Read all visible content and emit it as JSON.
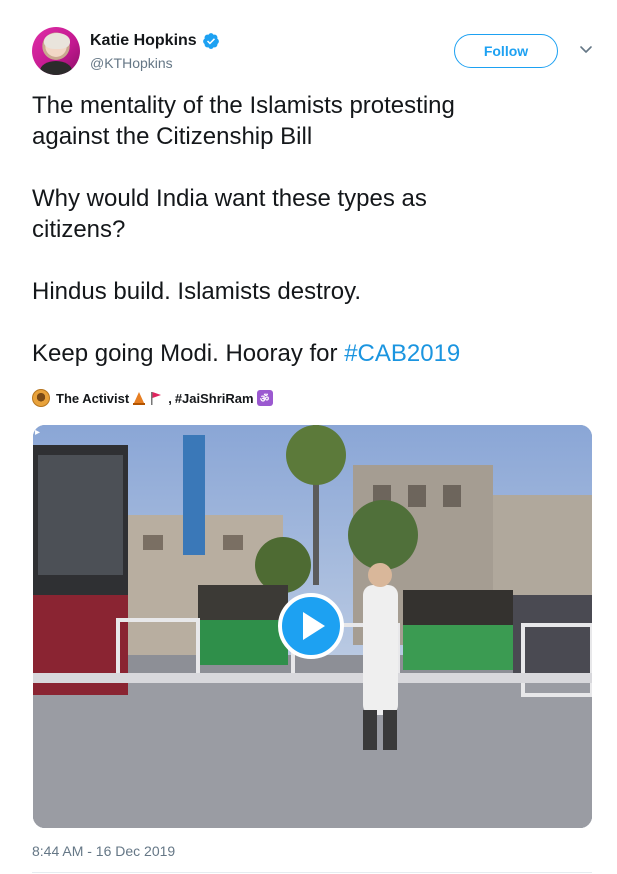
{
  "author": {
    "display_name": "Katie Hopkins",
    "handle": "@KTHopkins",
    "verified": true
  },
  "actions": {
    "follow_label": "Follow",
    "caret_icon": "chevron-down-icon"
  },
  "tweet": {
    "lines": [
      "The mentality of the Islamists protesting",
      "against the Citizenship Bill",
      "Why would India want these types as",
      "citizens?",
      "Hindus build. Islamists destroy."
    ],
    "last_line_text": "Keep going Modi. Hooray for ",
    "hashtag": "#CAB2019"
  },
  "media_attribution": {
    "name": "The Activist",
    "separator": ",",
    "tag": "#JaiShriRam",
    "om_glyph": "ॐ"
  },
  "media": {
    "type": "video",
    "play_icon": "play-icon"
  },
  "timestamp": "8:44 AM - 16 Dec 2019",
  "colors": {
    "accent": "#1da1f2",
    "hashtag": "#1b95e0",
    "secondary_text": "#657786"
  }
}
